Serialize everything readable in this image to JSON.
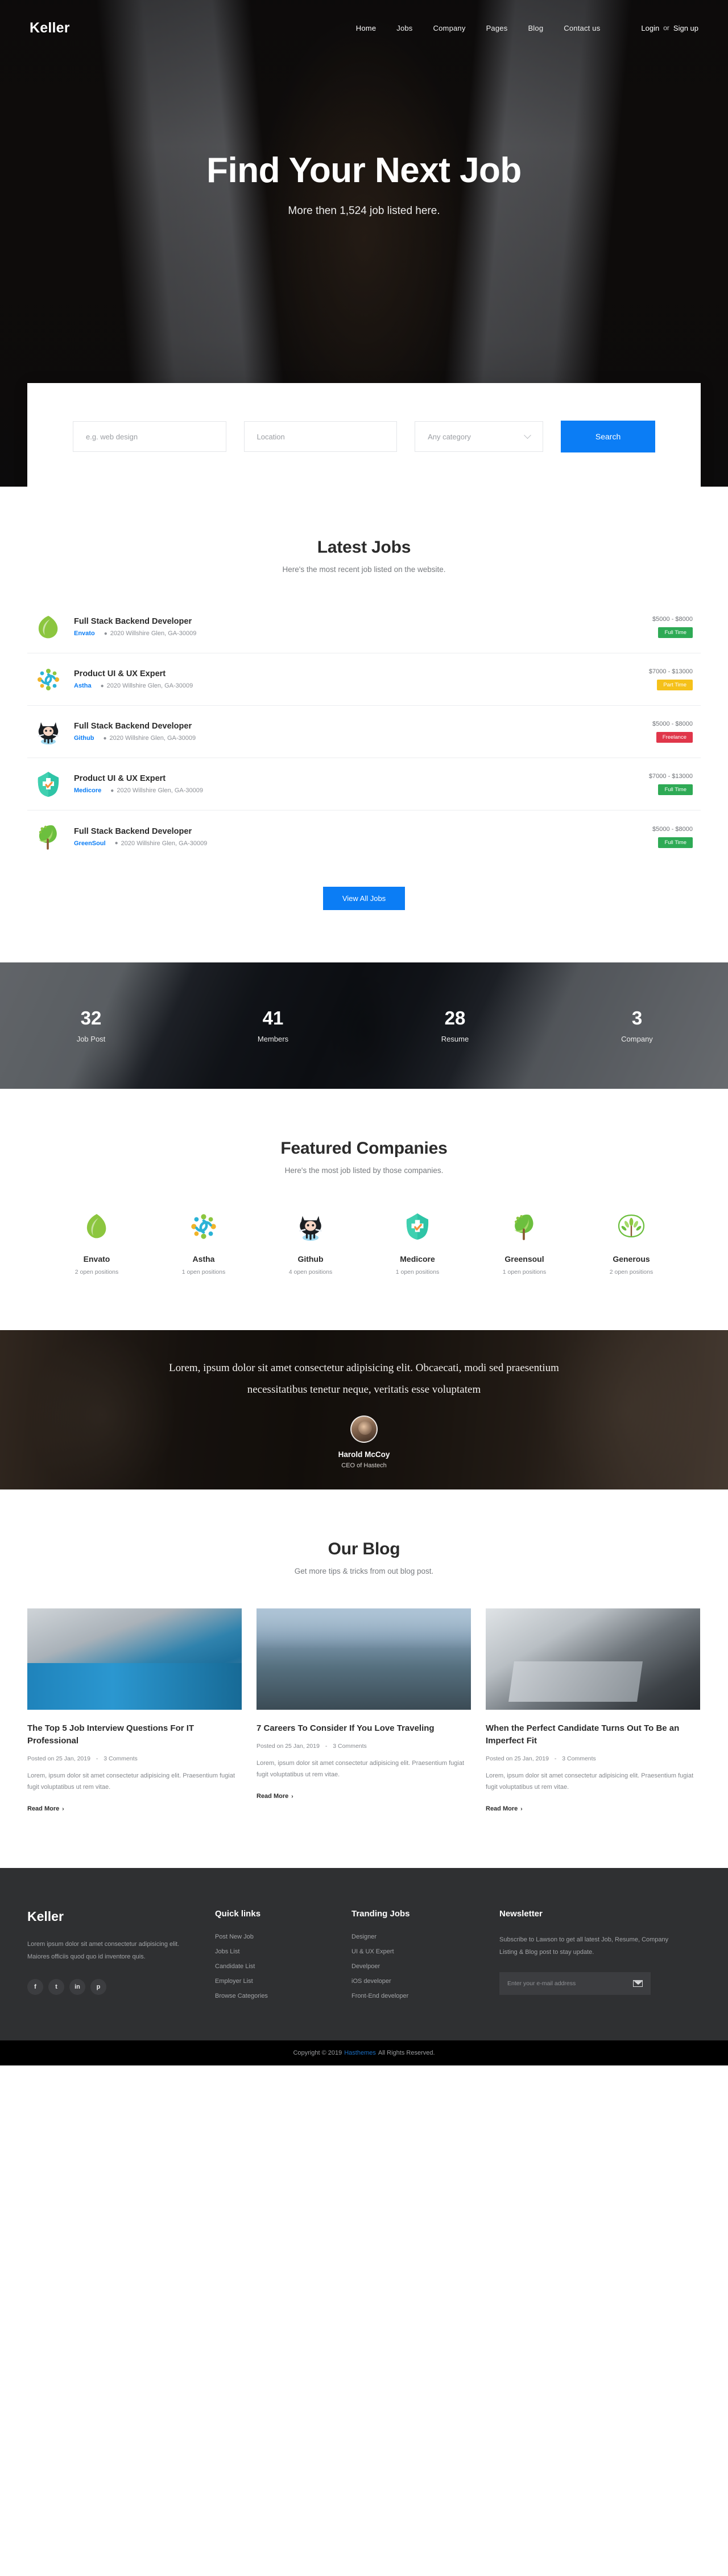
{
  "brand": "Keller",
  "nav": {
    "items": [
      {
        "label": "Home",
        "active": true
      },
      {
        "label": "Jobs",
        "active": false
      },
      {
        "label": "Company",
        "active": false
      },
      {
        "label": "Pages",
        "active": false
      },
      {
        "label": "Blog",
        "active": false
      },
      {
        "label": "Contact us",
        "active": false
      }
    ],
    "login": "Login",
    "separator": "or",
    "signup": "Sign up"
  },
  "hero": {
    "title": "Find Your Next Job",
    "subtitle": "More then 1,524 job listed here."
  },
  "search": {
    "keyword_placeholder": "e.g. web design",
    "location_placeholder": "Location",
    "category_value": "Any category",
    "button": "Search"
  },
  "latest_jobs": {
    "title": "Latest Jobs",
    "subtitle": "Here's the most recent job listed on the website.",
    "view_all": "View All Jobs",
    "rows": [
      {
        "title": "Full Stack Backend Developer",
        "company": "Envato",
        "location": "2020 Willshire Glen, GA-30009",
        "salary": "$5000 - $8000",
        "badge": "Full Time",
        "badge_type": "fulltime",
        "logo": "envato-leaf-logo"
      },
      {
        "title": "Product UI & UX Expert",
        "company": "Astha",
        "location": "2020 Willshire Glen, GA-30009",
        "salary": "$7000 - $13000",
        "badge": "Part Time",
        "badge_type": "parttime",
        "logo": "astha-people-logo"
      },
      {
        "title": "Full Stack Backend Developer",
        "company": "Github",
        "location": "2020 Willshire Glen, GA-30009",
        "salary": "$5000 - $8000",
        "badge": "Freelance",
        "badge_type": "freelance",
        "logo": "github-octocat-logo"
      },
      {
        "title": "Product UI & UX Expert",
        "company": "Medicore",
        "location": "2020 Willshire Glen, GA-30009",
        "salary": "$7000 - $13000",
        "badge": "Full Time",
        "badge_type": "fulltime",
        "logo": "medicore-cross-logo"
      },
      {
        "title": "Full Stack Backend Developer",
        "company": "GreenSoul",
        "location": "2020 Willshire Glen, GA-30009",
        "salary": "$5000 - $8000",
        "badge": "Full Time",
        "badge_type": "fulltime",
        "logo": "greensoul-tree-logo"
      }
    ]
  },
  "counters": [
    {
      "value": "32",
      "label": "Job Post"
    },
    {
      "value": "41",
      "label": "Members"
    },
    {
      "value": "28",
      "label": "Resume"
    },
    {
      "value": "3",
      "label": "Company"
    }
  ],
  "featured": {
    "title": "Featured Companies",
    "subtitle": "Here's the most job listed by those companies.",
    "companies": [
      {
        "name": "Envato",
        "positions": "2 open positions",
        "logo": "envato-leaf-logo"
      },
      {
        "name": "Astha",
        "positions": "1 open positions",
        "logo": "astha-people-logo"
      },
      {
        "name": "Github",
        "positions": "4 open positions",
        "logo": "github-octocat-logo"
      },
      {
        "name": "Medicore",
        "positions": "1 open positions",
        "logo": "medicore-cross-logo"
      },
      {
        "name": "Greensoul",
        "positions": "1 open positions",
        "logo": "greensoul-tree-logo"
      },
      {
        "name": "Generous",
        "positions": "2 open positions",
        "logo": "generous-wheat-logo"
      }
    ]
  },
  "testimonial": {
    "quote": "Lorem, ipsum dolor sit amet consectetur adipisicing elit. Obcaecati, modi sed praesentium necessitatibus tenetur neque, veritatis esse voluptatem",
    "author": "Harold McCoy",
    "role": "CEO of Hastech"
  },
  "blog": {
    "title": "Our Blog",
    "subtitle": "Get more tips & tricks from out blog post.",
    "posts": [
      {
        "title": "The Top 5 Job Interview Questions For IT Professional",
        "posted": "Posted on 25 Jan, 2019",
        "comments": "3 Comments",
        "excerpt": "Lorem, ipsum dolor sit amet consectetur adipisicing elit. Praesentium fugiat fugit voluptatibus ut rem vitae.",
        "read_more": "Read More"
      },
      {
        "title": "7 Careers To Consider If You Love Traveling",
        "posted": "Posted on 25 Jan, 2019",
        "comments": "3 Comments",
        "excerpt": "Lorem, ipsum dolor sit amet consectetur adipisicing elit. Praesentium fugiat fugit voluptatibus ut rem vitae.",
        "read_more": "Read More"
      },
      {
        "title": "When the Perfect Candidate Turns Out To Be an Imperfect Fit",
        "posted": "Posted on 25 Jan, 2019",
        "comments": "3 Comments",
        "excerpt": "Lorem, ipsum dolor sit amet consectetur adipisicing elit. Praesentium fugiat fugit voluptatibus ut rem vitae.",
        "read_more": "Read More"
      }
    ]
  },
  "footer": {
    "brand": "Keller",
    "about": "Lorem ipsum dolor sit amet consectetur adipisicing elit. Maiores officiis quod quo id inventore quis.",
    "socials": [
      {
        "name": "facebook-icon",
        "glyph": "f"
      },
      {
        "name": "twitter-icon",
        "glyph": "t"
      },
      {
        "name": "linkedin-icon",
        "glyph": "in"
      },
      {
        "name": "pinterest-icon",
        "glyph": "p"
      }
    ],
    "quick_links": {
      "title": "Quick links",
      "items": [
        "Post New Job",
        "Jobs List",
        "Candidate List",
        "Employer List",
        "Browse Categories"
      ]
    },
    "trending_jobs": {
      "title": "Tranding Jobs",
      "items": [
        "Designer",
        "UI & UX Expert",
        "Develpoer",
        "iOS developer",
        "Front-End developer"
      ]
    },
    "newsletter": {
      "title": "Newsletter",
      "description": "Subscribe to Lawson to get all latest Job, Resume, Company Listing & Blog post to stay update.",
      "placeholder": "Enter your e-mail address"
    },
    "copyright_pre": "Copyright © 2019",
    "copyright_link": "Hasthemes",
    "copyright_post": "All Rights Reserved."
  },
  "colors": {
    "accent": "#0b7df5",
    "fulltime": "#2eaa55",
    "parttime": "#f5c11a",
    "freelance": "#e0364a",
    "footer_bg": "#2f3032"
  }
}
